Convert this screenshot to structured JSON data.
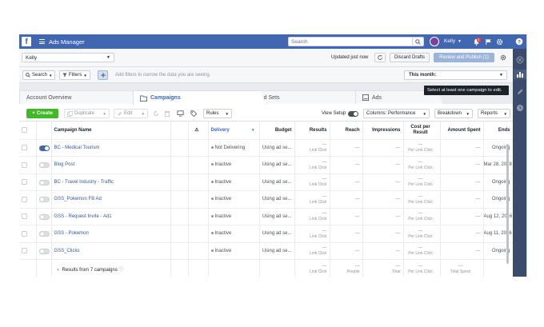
{
  "header": {
    "logo": "f",
    "app_title": "Ads Manager",
    "search_placeholder": "Search",
    "user_name": "Kelly",
    "notification_count": "1"
  },
  "account": {
    "selected": "Kelly",
    "updated_text": "Updated just now",
    "discard_label": "Discard Drafts",
    "review_label": "Review and Publish (1)"
  },
  "filters": {
    "search_label": "Search",
    "filters_label": "Filters",
    "hint": "Add filters to narrow the data you are seeing.",
    "date_range": "This month:"
  },
  "tooltip": "Select at least one campaign to edit.",
  "tabs": [
    {
      "label": "Account Overview"
    },
    {
      "label": "Campaigns"
    },
    {
      "label": "Ad Sets"
    },
    {
      "label": "Ads"
    }
  ],
  "toolbar": {
    "create_label": "Create",
    "duplicate_label": "Duplicate",
    "edit_label": "Edit",
    "rules_label": "Rules",
    "view_setup_label": "View Setup",
    "columns_label": "Columns: Performance",
    "breakdown_label": "Breakdown",
    "reports_label": "Reports"
  },
  "table": {
    "headers": {
      "name": "Campaign Name",
      "delivery": "Delivery",
      "budget": "Budget",
      "results": "Results",
      "reach": "Reach",
      "impressions": "Impressions",
      "cost_per_result": "Cost per Result",
      "amount_spent": "Amount Spent",
      "ends": "Ends"
    },
    "rows": [
      {
        "name": "BC - Medical Tourism",
        "on": true,
        "delivery": "Not Delivering",
        "budget": "Using ad se...",
        "results": "—",
        "results_sub": "Link Click",
        "reach": "—",
        "impressions": "—",
        "cost": "—",
        "cost_sub": "Per Link Click",
        "spent": "—",
        "ends": "Ongoing"
      },
      {
        "name": "Blog Post",
        "on": false,
        "delivery": "Inactive",
        "budget": "Using ad se...",
        "results": "—",
        "results_sub": "Link Click",
        "reach": "—",
        "impressions": "—",
        "cost": "—",
        "cost_sub": "Per Link Click",
        "spent": "—",
        "ends": "Mar 28, 2018"
      },
      {
        "name": "BC - Travel Industry - Traffic",
        "on": false,
        "delivery": "Inactive",
        "budget": "Using ad se...",
        "results": "—",
        "results_sub": "Link Click",
        "reach": "—",
        "impressions": "—",
        "cost": "—",
        "cost_sub": "Per Link Click",
        "spent": "—",
        "ends": "Ongoing"
      },
      {
        "name": "GSS_Pokemon FB Ad",
        "on": false,
        "delivery": "Inactive",
        "budget": "Using ad se...",
        "results": "—",
        "results_sub": "Link Click",
        "reach": "—",
        "impressions": "—",
        "cost": "—",
        "cost_sub": "Per Link Click",
        "spent": "—",
        "ends": "Ongoing"
      },
      {
        "name": "GSS - Request Invite - Ad1",
        "on": false,
        "delivery": "Inactive",
        "budget": "Using ad se...",
        "results": "—",
        "results_sub": "Link Click",
        "reach": "—",
        "impressions": "—",
        "cost": "—",
        "cost_sub": "Per Link Click",
        "spent": "—",
        "ends": "Aug 12, 2016"
      },
      {
        "name": "GSS - Pokemon",
        "on": false,
        "delivery": "Inactive",
        "budget": "Using ad se...",
        "results": "—",
        "results_sub": "Link Click",
        "reach": "—",
        "impressions": "—",
        "cost": "—",
        "cost_sub": "Per Link Click",
        "spent": "—",
        "ends": "Aug 11, 2016"
      },
      {
        "name": "GSS_Clicks",
        "on": false,
        "delivery": "Inactive",
        "budget": "Using ad se...",
        "results": "—",
        "results_sub": "Link Click",
        "reach": "—",
        "impressions": "—",
        "cost": "—",
        "cost_sub": "Per Link Click",
        "spent": "—",
        "ends": "Ongoing"
      }
    ],
    "totals": {
      "label": "Results from 7 campaigns",
      "results": "—",
      "results_sub": "Link Click",
      "reach": "—",
      "reach_sub": "People",
      "impressions": "—",
      "impressions_sub": "Total",
      "cost": "—",
      "cost_sub": "Per Link Click",
      "spent": "—",
      "spent_sub": "Total Spent"
    }
  },
  "colors": {
    "brand": "#4267b2",
    "create": "#42b72a",
    "link": "#365899"
  }
}
